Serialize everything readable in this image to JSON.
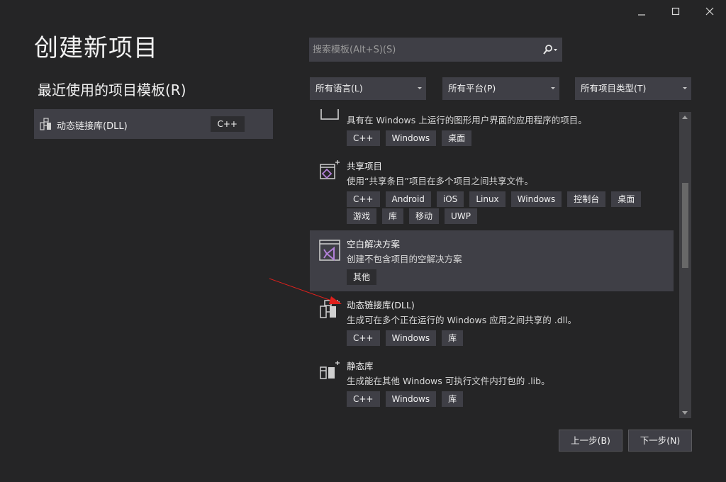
{
  "window": {
    "title": "创建新项目"
  },
  "recent": {
    "heading": "最近使用的项目模板(R)",
    "items": [
      {
        "label": "动态链接库(DLL)",
        "tag": "C++",
        "icon": "dll-icon"
      }
    ]
  },
  "search": {
    "placeholder": "搜索模板(Alt+S)(S)",
    "value": ""
  },
  "filters": {
    "language": "所有语言(L)",
    "platform": "所有平台(P)",
    "project_type": "所有项目类型(T)"
  },
  "templates": [
    {
      "name": "",
      "description": "具有在 Windows 上运行的图形用户界面的应用程序的项目。",
      "tags": [
        "C++",
        "Windows",
        "桌面"
      ],
      "icon": "desktop-app-icon"
    },
    {
      "name": "共享项目",
      "description": "使用“共享条目”项目在多个项目之间共享文件。",
      "tags": [
        "C++",
        "Android",
        "iOS",
        "Linux",
        "Windows",
        "控制台",
        "桌面",
        "游戏",
        "库",
        "移动",
        "UWP"
      ],
      "icon": "shared-project-icon"
    },
    {
      "name": "空白解决方案",
      "description": "创建不包含项目的空解决方案",
      "tags": [
        "其他"
      ],
      "icon": "visual-studio-solution-icon",
      "selected": true
    },
    {
      "name": "动态链接库(DLL)",
      "description": "生成可在多个正在运行的 Windows 应用之间共享的 .dll。",
      "tags": [
        "C++",
        "Windows",
        "库"
      ],
      "icon": "dll-icon"
    },
    {
      "name": "静态库",
      "description": "生成能在其他 Windows 可执行文件内打包的 .lib。",
      "tags": [
        "C++",
        "Windows",
        "库"
      ],
      "icon": "static-library-icon"
    }
  ],
  "buttons": {
    "back": "上一步(B)",
    "next": "下一步(N)"
  },
  "colors": {
    "background": "#252526",
    "panel": "#3f3f46",
    "annotation_arrow": "#e0201c",
    "vs_purple": "#b180d7"
  }
}
